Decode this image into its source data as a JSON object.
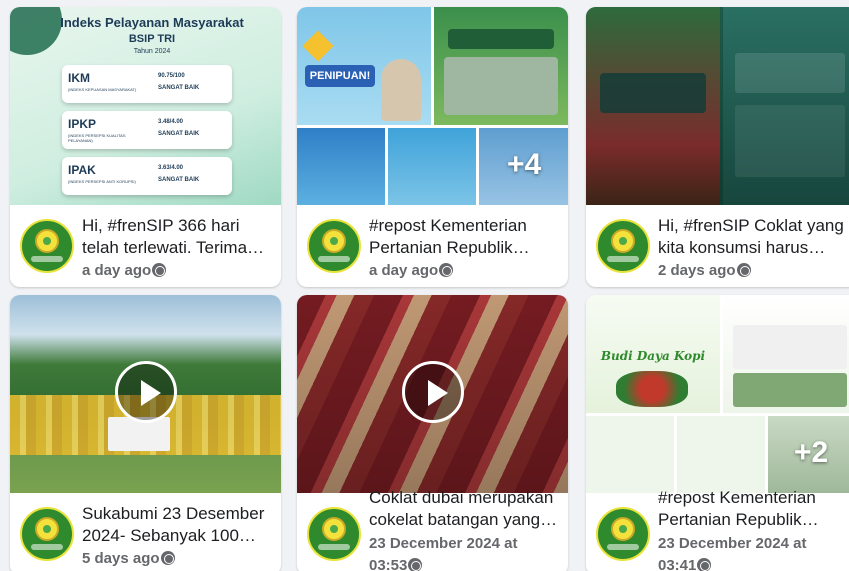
{
  "posts": [
    {
      "caption": "Hi, #frenSIP 366 hari telah terlewati. Terima…",
      "time": "a day ago"
    },
    {
      "caption": "#repost Kementerian Pertanian Republik…",
      "time": "a day ago"
    },
    {
      "caption": "Hi, #frenSIP Coklat yang kita konsumsi harus…",
      "time": "2 days ago"
    },
    {
      "caption": "Sukabumi 23 Desember 2024- Sebanyak 100…",
      "time": "5 days ago"
    },
    {
      "caption": "Coklat dubai merupakan cokelat batangan yang…",
      "time": "23 December 2024 at 03:53"
    },
    {
      "caption": "#repost Kementerian Pertanian Republik…",
      "time": "23 December 2024 at 03:41"
    }
  ],
  "infographic": {
    "title": "Indeks Pelayanan Masyarakat",
    "subtitle": "BSIP TRI",
    "year": "Tahun 2024",
    "rows": [
      {
        "code": "IKM",
        "desc": "(INDEKS KEPUASAN MASYARAKAT)",
        "score": "90.75/100",
        "grade": "SANGAT BAIK"
      },
      {
        "code": "IPKP",
        "desc": "(INDEKS PERSEPSI KUALITAS PELAYANAN)",
        "score": "3.48/4.00",
        "grade": "SANGAT BAIK"
      },
      {
        "code": "IPAK",
        "desc": "(INDEKS PERSEPSI ANTI KORUPSI)",
        "score": "3.63/4.00",
        "grade": "SANGAT BAIK"
      }
    ]
  },
  "thumb2": {
    "banner": "PENIPUAN!",
    "overlay": "+4"
  },
  "thumb6": {
    "title": "Budi Daya Kopi",
    "overlay": "+2"
  },
  "colors": {
    "page": "#f0f2f5",
    "text": "#1c1e21",
    "secondary": "#65676b",
    "avatar": "#2f8a2d"
  }
}
